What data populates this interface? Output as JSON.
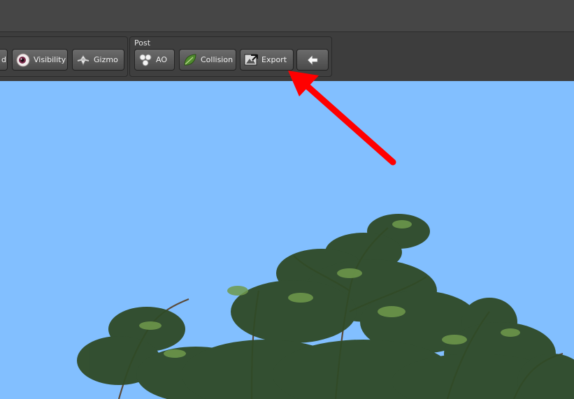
{
  "toolbar": {
    "left_group": {
      "partial_label": "d",
      "visibility_label": "Visibility",
      "gizmo_label": "Gizmo"
    },
    "post_group": {
      "title": "Post",
      "ao_label": "AO",
      "collision_label": "Collision",
      "export_label": "Export"
    }
  },
  "colors": {
    "sky": "#82bfff",
    "titlebar": "#464646",
    "toolbar": "#3d3d3d",
    "annotation_arrow": "#ff0000"
  },
  "icons": [
    "eye-icon",
    "gizmo-icon",
    "ao-spheres-icon",
    "leaf-icon",
    "export-image-icon",
    "back-arrow-icon"
  ]
}
